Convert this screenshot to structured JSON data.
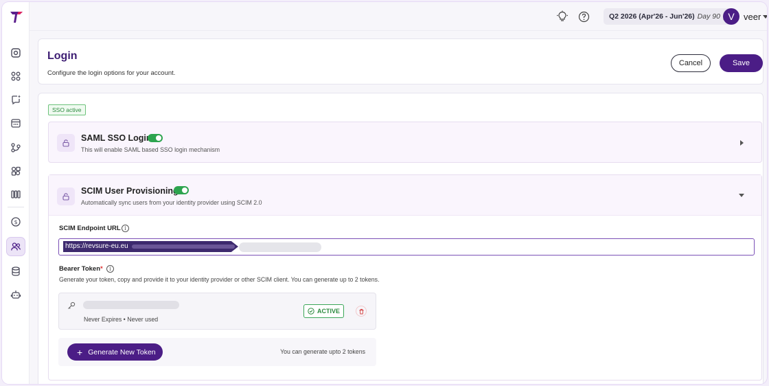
{
  "topbar": {
    "period_label": "Q2 2026 (Apr'26 - Jun'26)",
    "period_day": "Day 90",
    "avatar_initial": "V",
    "username": "veer"
  },
  "header": {
    "title": "Login",
    "subtitle": "Configure the login options for your account.",
    "cancel_label": "Cancel",
    "save_label": "Save"
  },
  "badge": {
    "sso_active": "SSO active"
  },
  "saml": {
    "title": "SAML SSO Login",
    "description": "This will enable SAML based SSO login mechanism",
    "enabled": true
  },
  "scim": {
    "title": "SCIM User Provisioning",
    "description": "Automatically sync users from your identity provider using SCIM 2.0",
    "enabled": true,
    "endpoint_label": "SCIM Endpoint URL",
    "endpoint_value_visible": "https://revsure-eu.eu",
    "bearer_label": "Bearer Token",
    "bearer_required_mark": "*",
    "bearer_help": "Generate your token, copy and provide it to your identity provider or other SCIM client. You can generate up to 2 tokens.",
    "token": {
      "meta": "Never Expires • Never used",
      "status": "ACTIVE"
    },
    "generate_label": "Generate New Token",
    "generate_hint": "You can generate upto 2 tokens"
  },
  "colors": {
    "brand": "#4b1d86",
    "success": "#2ea44f",
    "danger": "#d33b3b"
  }
}
